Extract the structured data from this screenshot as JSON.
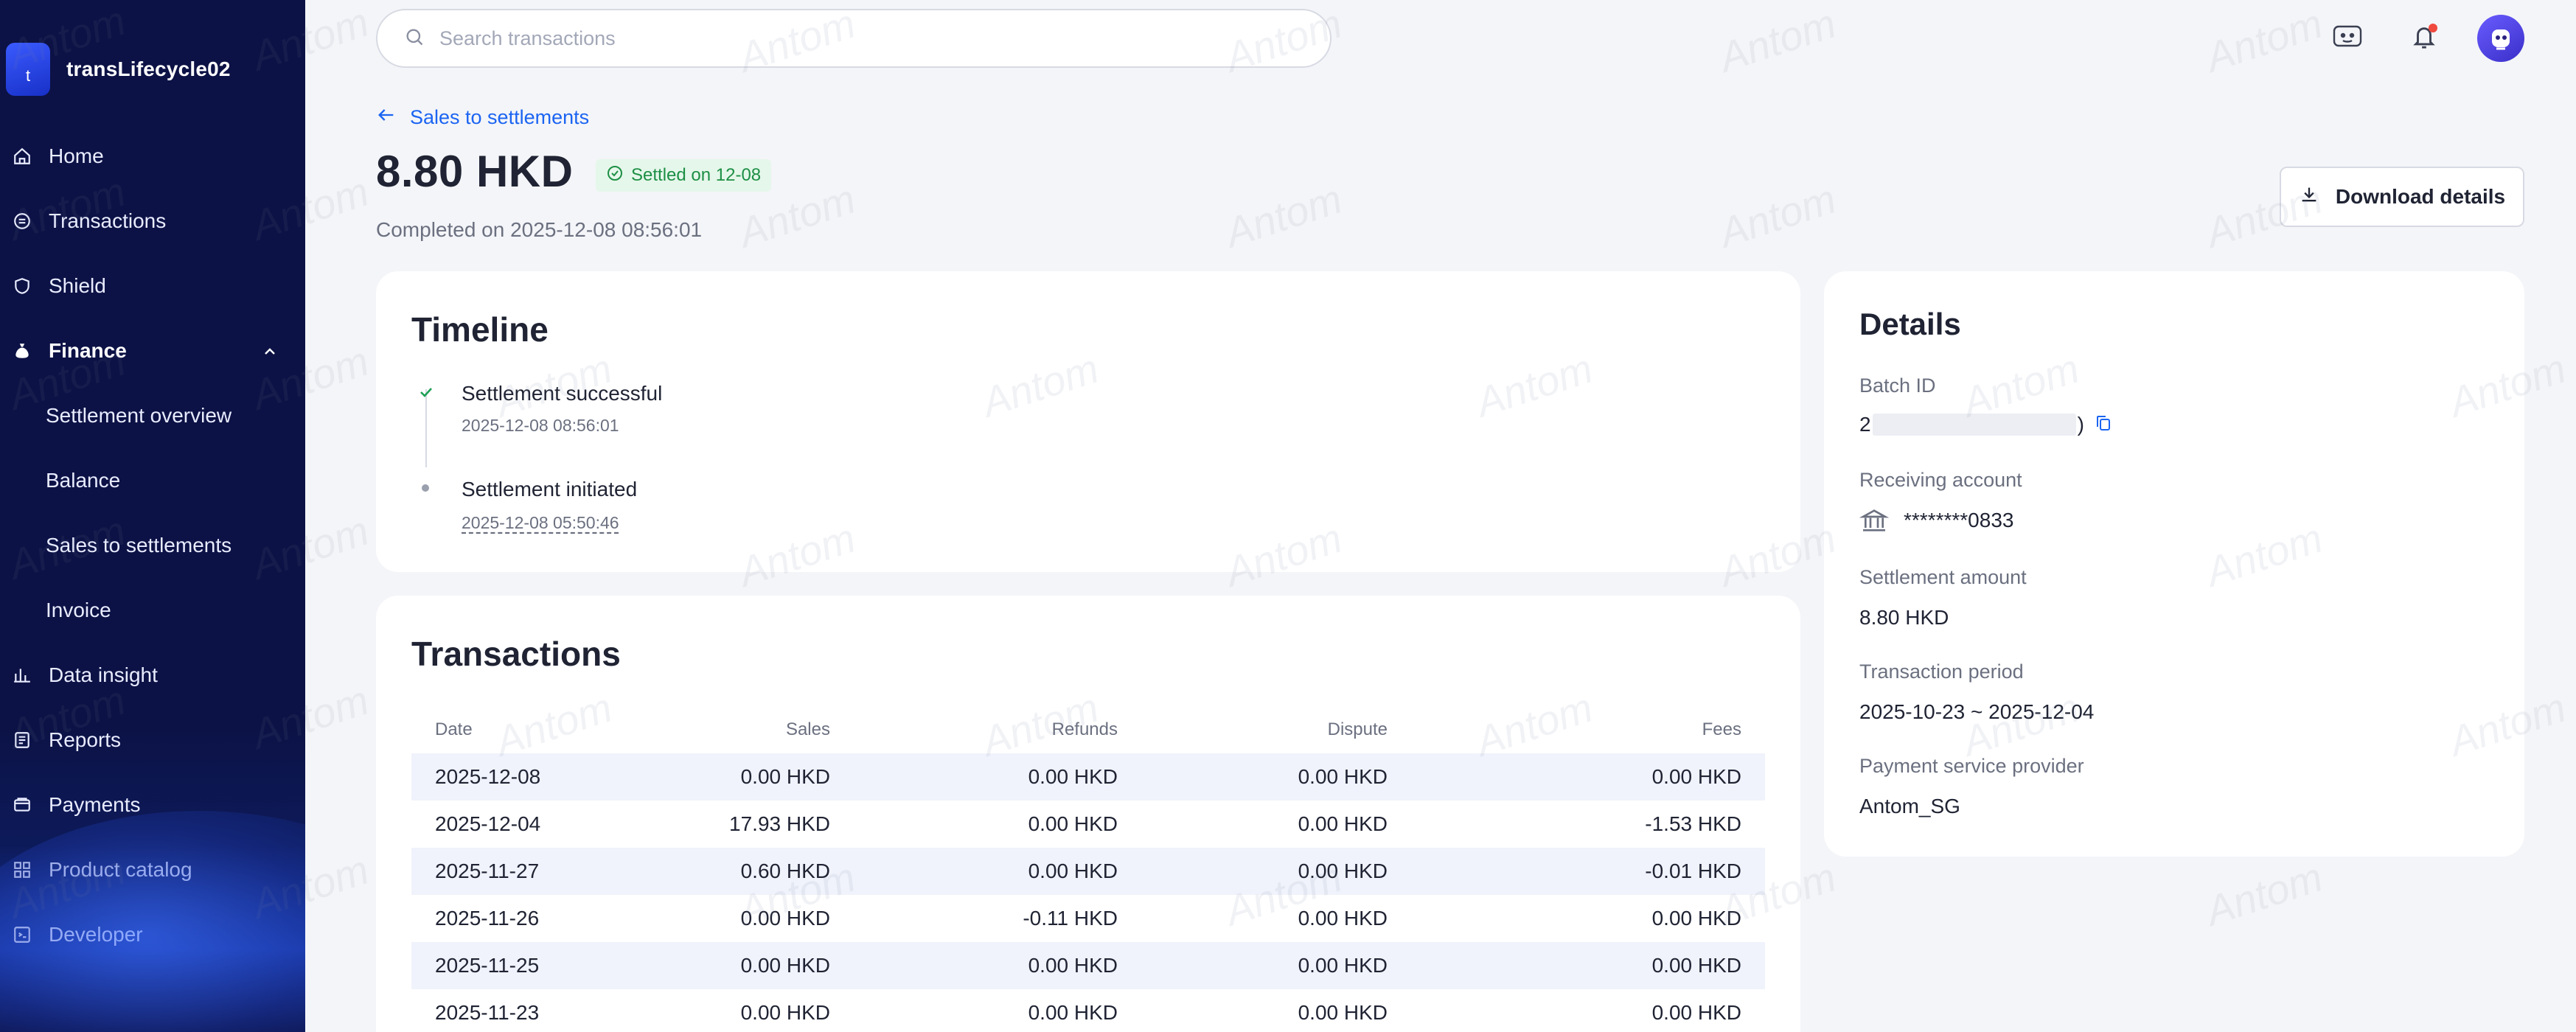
{
  "sidebar": {
    "account_initial": "t",
    "account_name": "transLifecycle02",
    "items": [
      {
        "label": "Home",
        "icon": "home-icon"
      },
      {
        "label": "Transactions",
        "icon": "transactions-icon"
      },
      {
        "label": "Shield",
        "icon": "shield-icon"
      },
      {
        "label": "Finance",
        "icon": "finance-icon",
        "expanded": true
      },
      {
        "label": "Data insight",
        "icon": "data-insight-icon"
      },
      {
        "label": "Reports",
        "icon": "reports-icon"
      },
      {
        "label": "Payments",
        "icon": "payments-icon"
      },
      {
        "label": "Product catalog",
        "icon": "product-catalog-icon"
      },
      {
        "label": "Developer",
        "icon": "developer-icon"
      }
    ],
    "finance_sub": [
      {
        "label": "Settlement overview"
      },
      {
        "label": "Balance"
      },
      {
        "label": "Sales to settlements"
      },
      {
        "label": "Invoice"
      }
    ]
  },
  "search": {
    "placeholder": "Search transactions",
    "value": ""
  },
  "header": {
    "back_label": "Sales to settlements",
    "amount": "8.80 HKD",
    "status": "Settled on 12-08",
    "completed": "Completed on 2025-12-08 08:56:01",
    "download_label": "Download details"
  },
  "timeline": {
    "title": "Timeline",
    "events": [
      {
        "title": "Settlement successful",
        "time": "2025-12-08 08:56:01"
      },
      {
        "title": "Settlement initiated",
        "time": "2025-12-08 05:50:46"
      }
    ]
  },
  "transactions": {
    "title": "Transactions",
    "columns": [
      "Date",
      "Sales",
      "Refunds",
      "Dispute",
      "Fees"
    ],
    "rows": [
      [
        "2025-12-08",
        "0.00 HKD",
        "0.00 HKD",
        "0.00 HKD",
        "0.00 HKD"
      ],
      [
        "2025-12-04",
        "17.93 HKD",
        "0.00 HKD",
        "0.00 HKD",
        "-1.53 HKD"
      ],
      [
        "2025-11-27",
        "0.60 HKD",
        "0.00 HKD",
        "0.00 HKD",
        "-0.01 HKD"
      ],
      [
        "2025-11-26",
        "0.00 HKD",
        "-0.11 HKD",
        "0.00 HKD",
        "0.00 HKD"
      ],
      [
        "2025-11-25",
        "0.00 HKD",
        "0.00 HKD",
        "0.00 HKD",
        "0.00 HKD"
      ],
      [
        "2025-11-23",
        "0.00 HKD",
        "0.00 HKD",
        "0.00 HKD",
        "0.00 HKD"
      ]
    ]
  },
  "details": {
    "title": "Details",
    "batch_id_label": "Batch ID",
    "batch_id_first": "2",
    "batch_id_last": ")",
    "receiving_account_label": "Receiving account",
    "receiving_account": "********0833",
    "settlement_amount_label": "Settlement amount",
    "settlement_amount": "8.80 HKD",
    "transaction_period_label": "Transaction period",
    "transaction_period": "2025-10-23 ~ 2025-12-04",
    "psp_label": "Payment service provider",
    "psp": "Antom_SG"
  },
  "watermark_text": "Antom",
  "colors": {
    "sidebar_bg": "#0c1245",
    "accent": "#1b64f2",
    "success": "#1d8f45",
    "badge_bg": "#e5f7ea"
  }
}
